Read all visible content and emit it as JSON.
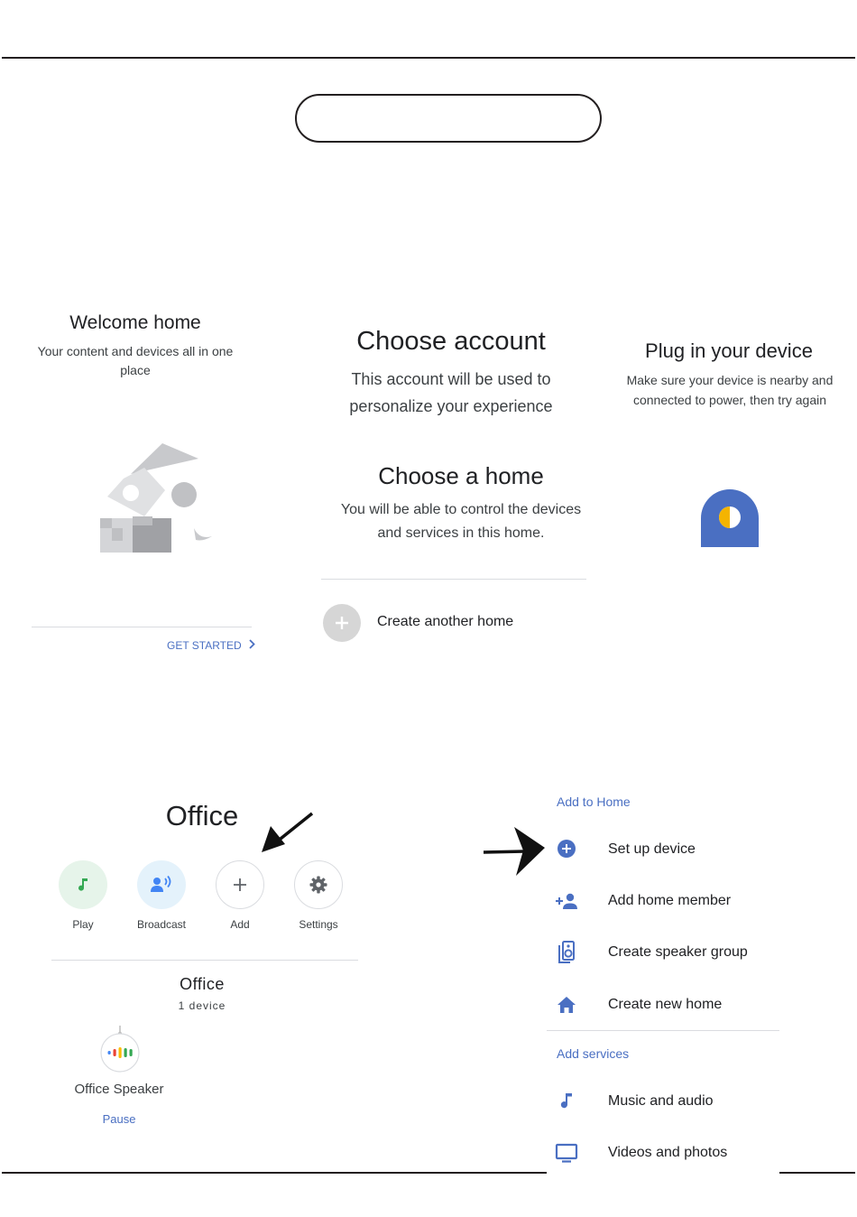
{
  "welcome": {
    "title": "Welcome home",
    "subtitle": "Your content and devices all in one place",
    "cta": "GET STARTED"
  },
  "choose_account": {
    "title": "Choose account",
    "subtitle": "This account will be used to personalize your experience"
  },
  "choose_home": {
    "title": "Choose a home",
    "subtitle": "You will be able to control the devices and services in this home.",
    "create_another": "Create another home"
  },
  "plug_in": {
    "title": "Plug in your device",
    "subtitle": "Make sure your device is nearby and connected to power, then try again"
  },
  "office": {
    "title": "Office",
    "actions": [
      {
        "label": "Play",
        "icon": "music-note-icon"
      },
      {
        "label": "Broadcast",
        "icon": "broadcast-icon"
      },
      {
        "label": "Add",
        "icon": "plus-icon"
      },
      {
        "label": "Settings",
        "icon": "gear-icon"
      }
    ],
    "room_name": "Office",
    "room_count": "1 device",
    "device_name": "Office Speaker",
    "device_action": "Pause"
  },
  "add_menu": {
    "add_to_home_header": "Add to Home",
    "add_to_home_items": [
      {
        "label": "Set up device",
        "icon": "add-circle-icon"
      },
      {
        "label": "Add home member",
        "icon": "person-add-icon"
      },
      {
        "label": "Create speaker group",
        "icon": "speaker-group-icon"
      },
      {
        "label": "Create new home",
        "icon": "home-icon"
      }
    ],
    "add_services_header": "Add services",
    "add_services_items": [
      {
        "label": "Music and audio",
        "icon": "music-note-icon"
      },
      {
        "label": "Videos and photos",
        "icon": "tv-icon"
      }
    ]
  },
  "colors": {
    "accent_blue": "#4a6fc2",
    "play_bg": "#e6f4ea",
    "play_icon": "#34a853",
    "broadcast_bg": "#e4f2fb",
    "broadcast_icon": "#4285f4",
    "pin_blue": "#4a6fc2",
    "pin_yellow": "#f4b400"
  }
}
